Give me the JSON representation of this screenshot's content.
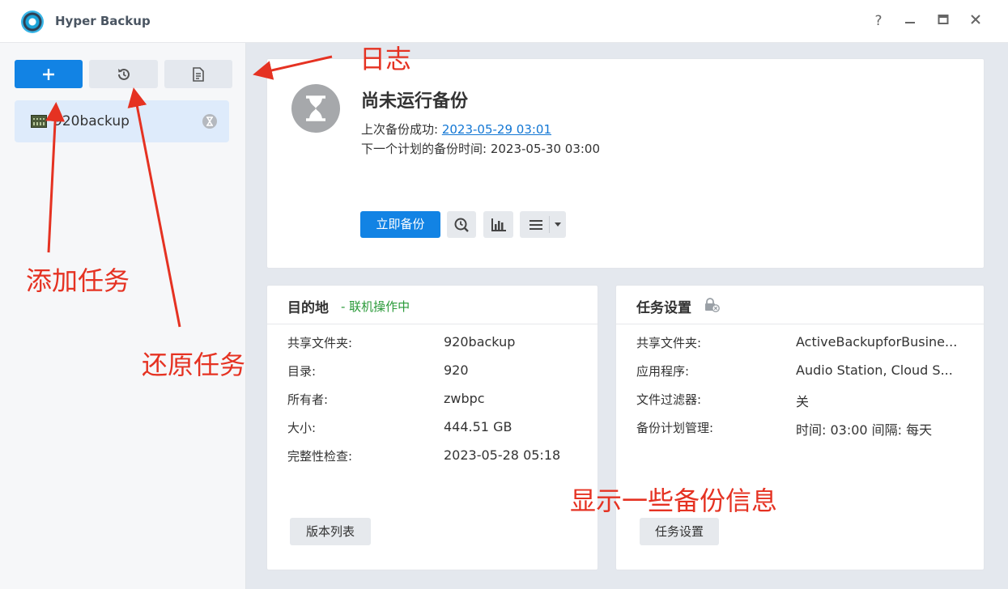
{
  "app": {
    "title": "Hyper Backup"
  },
  "window_controls": {
    "help": "?",
    "minimize": "—",
    "maximize": "□",
    "close": "✕"
  },
  "toolbar": {
    "add_icon": "plus-icon",
    "restore_icon": "history-icon",
    "log_icon": "document-icon"
  },
  "tasks": [
    {
      "name": "920backup",
      "icon": "nas-icon",
      "status_icon": "hourglass-icon"
    }
  ],
  "status": {
    "title": "尚未运行备份",
    "last_backup_label": "上次备份成功: ",
    "last_backup_value": "2023-05-29 03:01",
    "next_backup_label": "下一个计划的备份时间: ",
    "next_backup_value": "2023-05-30 03:00",
    "backup_now": "立即备份"
  },
  "destination": {
    "title": "目的地",
    "status": "- 联机操作中",
    "rows": [
      {
        "label": "共享文件夹:",
        "value": "920backup"
      },
      {
        "label": "目录:",
        "value": "920"
      },
      {
        "label": "所有者:",
        "value": "zwbpc"
      },
      {
        "label": "大小:",
        "value": "444.51 GB"
      },
      {
        "label": "完整性检查:",
        "value": "2023-05-28 05:18"
      }
    ],
    "button": "版本列表"
  },
  "task_settings": {
    "title": "任务设置",
    "rows": [
      {
        "label": "共享文件夹:",
        "value": "ActiveBackupforBusine..."
      },
      {
        "label": "应用程序:",
        "value": "Audio Station, Cloud S..."
      },
      {
        "label": "文件过滤器:",
        "value": "关"
      },
      {
        "label": "备份计划管理:",
        "value": "时间: 03:00 间隔: 每天"
      }
    ],
    "button": "任务设置"
  },
  "annotations": {
    "log": "日志",
    "add_task": "添加任务",
    "restore_task": "还原任务",
    "info": "显示一些备份信息"
  },
  "colors": {
    "accent": "#1283e4",
    "annotation": "#e53222",
    "online": "#2a9a39"
  }
}
